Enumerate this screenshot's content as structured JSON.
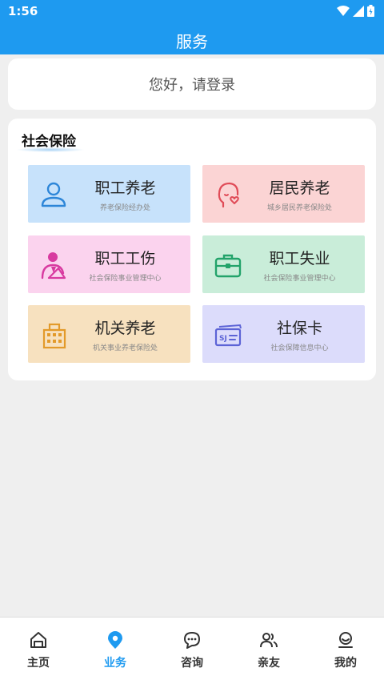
{
  "status_bar": {
    "time": "1:56"
  },
  "header": {
    "title": "服务"
  },
  "login": {
    "text": "您好，请登录"
  },
  "section": {
    "title": "社会保险",
    "tiles": [
      {
        "title": "职工养老",
        "subtitle": "养老保险经办处",
        "icon": "person-icon",
        "bg": "#c7e2fb",
        "color": "#2d86d8"
      },
      {
        "title": "居民养老",
        "subtitle": "城乡居民养老保险处",
        "icon": "face-heart-icon",
        "bg": "#fbd4d4",
        "color": "#e04b57"
      },
      {
        "title": "职工工伤",
        "subtitle": "社会保险事业管理中心",
        "icon": "worker-icon",
        "bg": "#fbd3ee",
        "color": "#d83aa0"
      },
      {
        "title": "职工失业",
        "subtitle": "社会保险事业管理中心",
        "icon": "briefcase-icon",
        "bg": "#c9edd9",
        "color": "#22a36a"
      },
      {
        "title": "机关养老",
        "subtitle": "机关事业养老保险处",
        "icon": "building-icon",
        "bg": "#f7e1bf",
        "color": "#e39a2a"
      },
      {
        "title": "社保卡",
        "subtitle": "社会保障信息中心",
        "icon": "card-icon",
        "bg": "#dcdcfb",
        "color": "#5c63d6"
      }
    ]
  },
  "nav": {
    "items": [
      {
        "label": "主页",
        "icon": "home-icon",
        "active": false
      },
      {
        "label": "业务",
        "icon": "location-icon",
        "active": true
      },
      {
        "label": "咨询",
        "icon": "chat-icon",
        "active": false
      },
      {
        "label": "亲友",
        "icon": "people-icon",
        "active": false
      },
      {
        "label": "我的",
        "icon": "profile-icon",
        "active": false
      }
    ]
  },
  "colors": {
    "primary": "#1e9af0",
    "background": "#efefef"
  }
}
